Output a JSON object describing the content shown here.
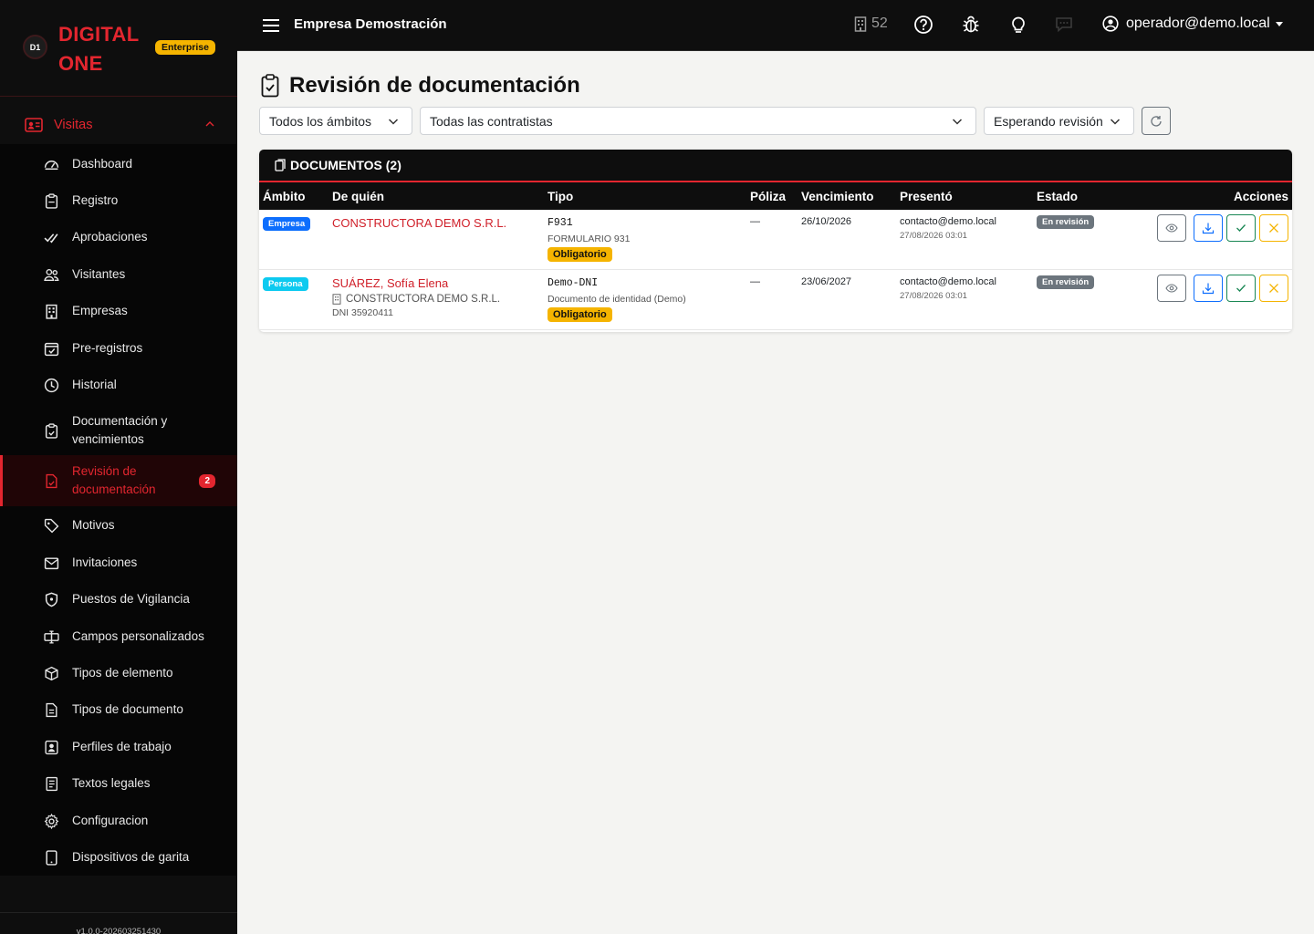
{
  "brand": {
    "logo_text": "D1",
    "name_line1": "DIGITAL",
    "name_line2": "ONE",
    "edition": "Enterprise"
  },
  "sidebar": {
    "section": "Visitas",
    "items": [
      {
        "label": "Dashboard",
        "icon": "dashboard-icon"
      },
      {
        "label": "Registro",
        "icon": "clipboard-icon"
      },
      {
        "label": "Aprobaciones",
        "icon": "double-check-icon"
      },
      {
        "label": "Visitantes",
        "icon": "people-icon"
      },
      {
        "label": "Empresas",
        "icon": "building-icon"
      },
      {
        "label": "Pre-registros",
        "icon": "calendar-check-icon"
      },
      {
        "label": "Historial",
        "icon": "clock-icon"
      },
      {
        "label": "Documentación y vencimientos",
        "icon": "clipboard-check-icon"
      },
      {
        "label": "Revisión de documentación",
        "icon": "file-check-icon",
        "badge": "2",
        "active": true
      },
      {
        "label": "Motivos",
        "icon": "tags-icon"
      },
      {
        "label": "Invitaciones",
        "icon": "envelope-icon"
      },
      {
        "label": "Puestos de Vigilancia",
        "icon": "shield-icon"
      },
      {
        "label": "Campos personalizados",
        "icon": "input-cursor-icon"
      },
      {
        "label": "Tipos de elemento",
        "icon": "box-icon"
      },
      {
        "label": "Tipos de documento",
        "icon": "file-text-icon"
      },
      {
        "label": "Perfiles de trabajo",
        "icon": "person-badge-icon"
      },
      {
        "label": "Textos legales",
        "icon": "journal-icon"
      },
      {
        "label": "Configuracion",
        "icon": "gear-icon"
      },
      {
        "label": "Dispositivos de garita",
        "icon": "tablet-icon"
      }
    ],
    "version": "v1.0.0-202603251430"
  },
  "topbar": {
    "company": "Empresa Demostración",
    "count": "52",
    "user": "operador@demo.local"
  },
  "page": {
    "title": "Revisión de documentación"
  },
  "filters": {
    "scope": "Todos los ámbitos",
    "contractor": "Todas las contratistas",
    "status": "Esperando revisión"
  },
  "table": {
    "title": "DOCUMENTOS (2)",
    "headers": {
      "scope": "Ámbito",
      "who": "De quién",
      "type": "Tipo",
      "policy": "Póliza",
      "expiry": "Vencimiento",
      "submitted": "Presentó",
      "status": "Estado",
      "actions": "Acciones"
    },
    "rows": [
      {
        "scope": "Empresa",
        "scope_color": "#0d6efd",
        "who": "CONSTRUCTORA DEMO S.R.L.",
        "company": "",
        "doc_id": "",
        "type_code": "F931",
        "type_name": "FORMULARIO 931",
        "required": "Obligatorio",
        "policy": "—",
        "expiry": "26/10/2026",
        "submitter": "contacto@demo.local",
        "submitted_at": "27/08/2026 03:01",
        "status": "En revisión"
      },
      {
        "scope": "Persona",
        "scope_color": "#0dcaf0",
        "who": "SUÁREZ, Sofía Elena",
        "company": "CONSTRUCTORA DEMO S.R.L.",
        "doc_id": "DNI 35920411",
        "type_code": "Demo-DNI",
        "type_name": "Documento de identidad (Demo)",
        "required": "Obligatorio",
        "policy": "—",
        "expiry": "23/06/2027",
        "submitter": "contacto@demo.local",
        "submitted_at": "27/08/2026 03:01",
        "status": "En revisión"
      }
    ]
  },
  "colors": {
    "accent": "#e3262f",
    "warning": "#f5b400",
    "primary": "#0d6efd",
    "success": "#198754",
    "secondary": "#6c757d"
  }
}
